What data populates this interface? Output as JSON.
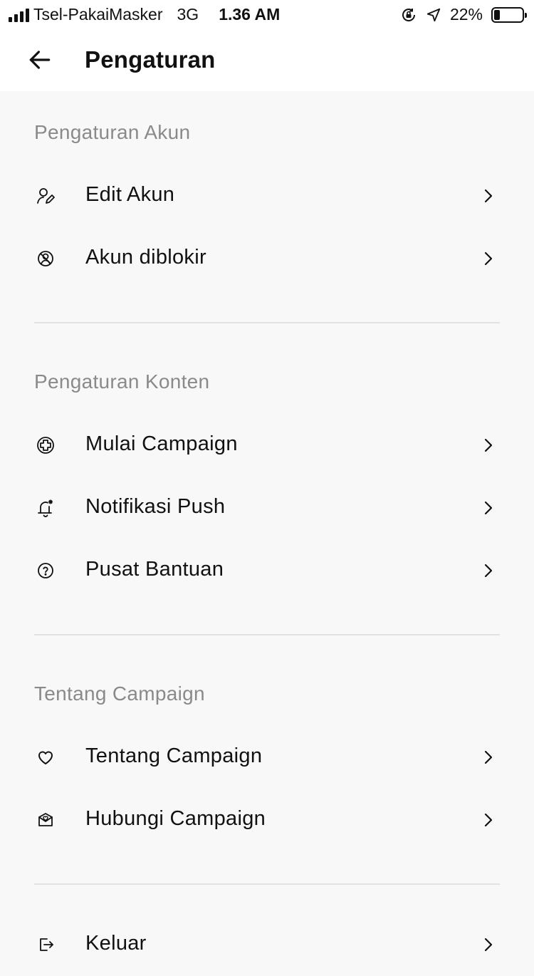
{
  "status_bar": {
    "carrier": "Tsel-PakaiMasker",
    "network": "3G",
    "time": "1.36 AM",
    "battery": "22%",
    "battery_level": 0.22,
    "icons": [
      "signal-icon",
      "rotation-lock-icon",
      "location-icon",
      "battery-icon"
    ]
  },
  "header": {
    "title": "Pengaturan",
    "back_icon": "arrow-left-icon"
  },
  "sections": {
    "account": {
      "title": "Pengaturan Akun",
      "items": [
        {
          "label": "Edit Akun",
          "icon": "user-edit-icon"
        },
        {
          "label": "Akun diblokir",
          "icon": "user-blocked-icon"
        }
      ]
    },
    "content": {
      "title": "Pengaturan Konten",
      "items": [
        {
          "label": "Mulai Campaign",
          "icon": "plus-circle-icon"
        },
        {
          "label": "Notifikasi Push",
          "icon": "bell-icon"
        },
        {
          "label": "Pusat Bantuan",
          "icon": "help-circle-icon"
        }
      ]
    },
    "about": {
      "title": "Tentang Campaign",
      "items": [
        {
          "label": "Tentang Campaign",
          "icon": "heart-icon"
        },
        {
          "label": "Hubungi Campaign",
          "icon": "mail-heart-icon"
        }
      ]
    },
    "logout": {
      "items": [
        {
          "label": "Keluar",
          "icon": "logout-icon"
        }
      ]
    }
  },
  "colors": {
    "background": "#f8f8f8",
    "bar_background": "#ffffff",
    "section_title": "#8a8a8a",
    "text": "#111111",
    "divider": "#e2e2e2"
  }
}
